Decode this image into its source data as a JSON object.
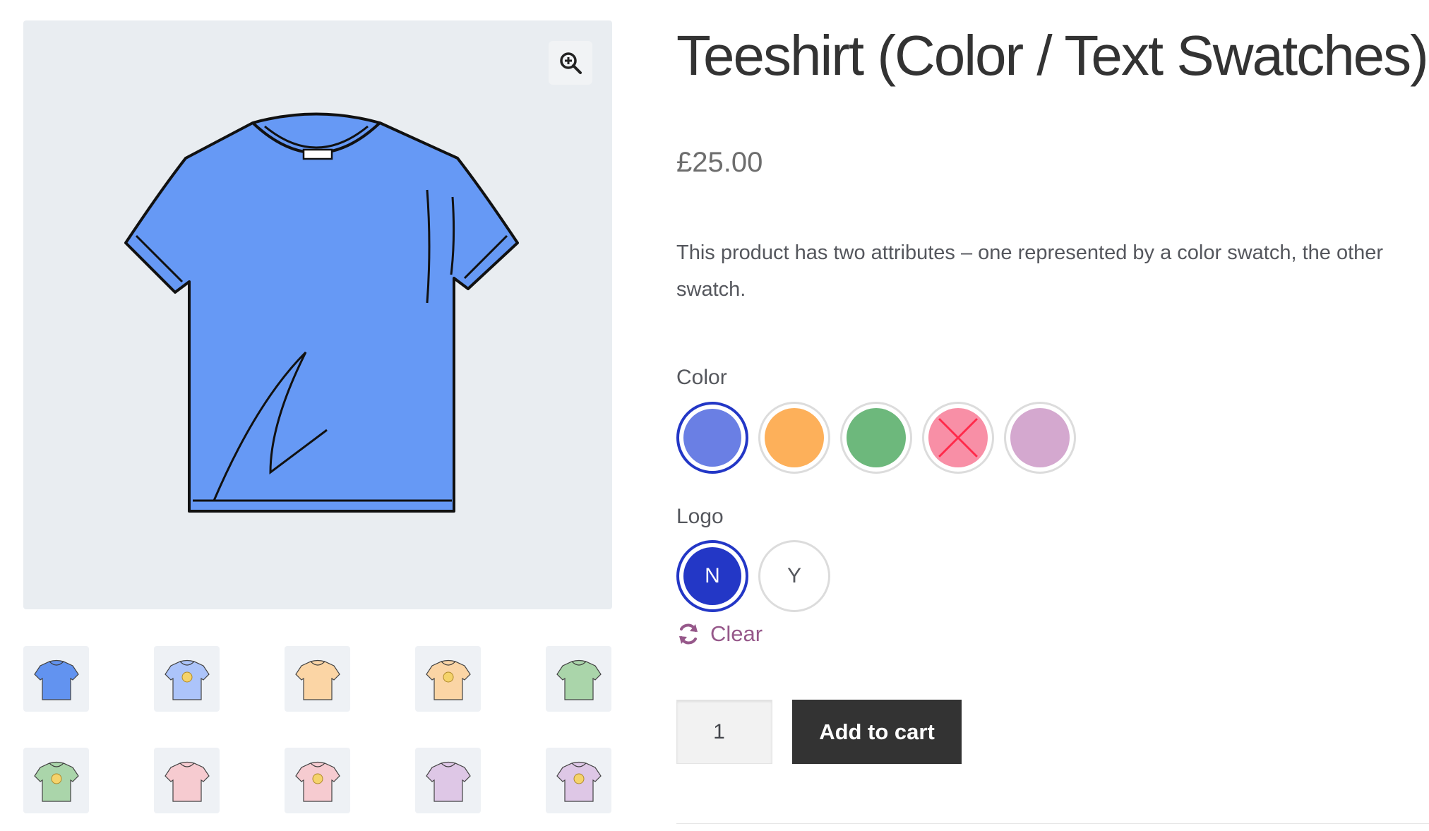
{
  "product": {
    "title": "Teeshirt (Color / Text Swatches)",
    "price": "£25.00",
    "description": "This product has two attributes – one represented by a color swatch, the other swatch."
  },
  "gallery": {
    "zoom_icon": "zoom-in-icon",
    "main_color": "#6699f5",
    "thumbnails": [
      {
        "color": "#5b8ef0",
        "logo": false
      },
      {
        "color": "#a9c2fb",
        "logo": true
      },
      {
        "color": "#fcd4a1",
        "logo": false
      },
      {
        "color": "#fcd4a1",
        "logo": true
      },
      {
        "color": "#a7d4a7",
        "logo": false
      },
      {
        "color": "#a7d4a7",
        "logo": true
      },
      {
        "color": "#f7c9cf",
        "logo": false
      },
      {
        "color": "#f7c9cf",
        "logo": true
      },
      {
        "color": "#dec5e6",
        "logo": false
      },
      {
        "color": "#dec5e6",
        "logo": true
      }
    ]
  },
  "attributes": {
    "color": {
      "label": "Color",
      "options": [
        {
          "color": "#6a7fe4",
          "selected": true,
          "unavailable": false
        },
        {
          "color": "#fdb05a",
          "selected": false,
          "unavailable": false
        },
        {
          "color": "#6db87c",
          "selected": false,
          "unavailable": false
        },
        {
          "color": "#f88fa6",
          "selected": false,
          "unavailable": true
        },
        {
          "color": "#d4a8cf",
          "selected": false,
          "unavailable": false
        }
      ]
    },
    "logo": {
      "label": "Logo",
      "options": [
        {
          "label": "N",
          "selected": true
        },
        {
          "label": "Y",
          "selected": false
        }
      ]
    }
  },
  "actions": {
    "clear_label": "Clear",
    "clear_icon": "refresh-icon",
    "quantity": "1",
    "add_to_cart_label": "Add to cart"
  },
  "colors": {
    "accent": "#2337c6",
    "link": "#96588a",
    "button": "#333333",
    "unavailable_cross": "#ff2a4a"
  }
}
